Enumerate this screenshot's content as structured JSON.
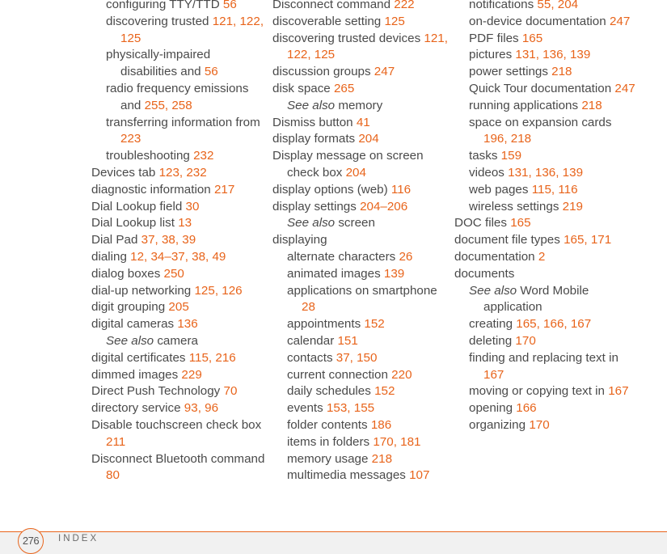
{
  "accent_color": "#e8641b",
  "footer": {
    "page_number": "276",
    "section": "INDEX"
  },
  "columns": [
    [
      {
        "level": 1,
        "text": "configuring TTY/TTD ",
        "pages": "56"
      },
      {
        "level": 1,
        "text": "discovering trusted ",
        "pages": "121, 122, 125"
      },
      {
        "level": 1,
        "text": "physically-impaired disabilities and ",
        "pages": "56"
      },
      {
        "level": 1,
        "text": "radio frequency emissions and ",
        "pages": "255, 258"
      },
      {
        "level": 1,
        "text": "transferring information from ",
        "pages": "223"
      },
      {
        "level": 1,
        "text": "troubleshooting ",
        "pages": "232"
      },
      {
        "level": 0,
        "text": "Devices tab ",
        "pages": "123, 232"
      },
      {
        "level": 0,
        "text": "diagnostic information ",
        "pages": "217"
      },
      {
        "level": 0,
        "text": "Dial Lookup field ",
        "pages": "30"
      },
      {
        "level": 0,
        "text": "Dial Lookup list ",
        "pages": "13"
      },
      {
        "level": 0,
        "text": "Dial Pad ",
        "pages": "37, 38, 39"
      },
      {
        "level": 0,
        "text": "dialing ",
        "pages": "12, 34–37, 38, 49"
      },
      {
        "level": 0,
        "text": "dialog boxes ",
        "pages": "250"
      },
      {
        "level": 0,
        "text": "dial-up networking ",
        "pages": "125, 126"
      },
      {
        "level": 0,
        "text": "digit grouping ",
        "pages": "205"
      },
      {
        "level": 0,
        "text": "digital cameras ",
        "pages": "136"
      },
      {
        "level": 1,
        "see_also": "See also",
        "text": " camera",
        "pages": ""
      },
      {
        "level": 0,
        "text": "digital certificates ",
        "pages": "115, 216"
      },
      {
        "level": 0,
        "text": "dimmed images ",
        "pages": "229"
      },
      {
        "level": 0,
        "text": "Direct Push Technology ",
        "pages": "70"
      },
      {
        "level": 0,
        "text": "directory service ",
        "pages": "93, 96"
      },
      {
        "level": 0,
        "text": "Disable touchscreen check box ",
        "pages": "211"
      },
      {
        "level": 0,
        "text": "Disconnect Bluetooth command ",
        "pages": "80"
      }
    ],
    [
      {
        "level": 0,
        "text": "Disconnect command ",
        "pages": "222"
      },
      {
        "level": 0,
        "text": "discoverable setting ",
        "pages": "125"
      },
      {
        "level": 0,
        "text": "discovering trusted devices ",
        "pages": "121, 122, 125"
      },
      {
        "level": 0,
        "text": "discussion groups ",
        "pages": "247"
      },
      {
        "level": 0,
        "text": "disk space ",
        "pages": "265"
      },
      {
        "level": 1,
        "see_also": "See also",
        "text": " memory",
        "pages": ""
      },
      {
        "level": 0,
        "text": "Dismiss button ",
        "pages": "41"
      },
      {
        "level": 0,
        "text": "display formats ",
        "pages": "204"
      },
      {
        "level": 0,
        "text": "Display message on screen check box ",
        "pages": "204"
      },
      {
        "level": 0,
        "text": "display options (web) ",
        "pages": "116"
      },
      {
        "level": 0,
        "text": "display settings ",
        "pages": "204–206"
      },
      {
        "level": 1,
        "see_also": "See also",
        "text": " screen",
        "pages": ""
      },
      {
        "level": 0,
        "text": "displaying",
        "pages": ""
      },
      {
        "level": 1,
        "text": "alternate characters ",
        "pages": "26"
      },
      {
        "level": 1,
        "text": "animated images ",
        "pages": "139"
      },
      {
        "level": 1,
        "text": "applications on smartphone ",
        "pages": "28"
      },
      {
        "level": 1,
        "text": "appointments ",
        "pages": "152"
      },
      {
        "level": 1,
        "text": "calendar ",
        "pages": "151"
      },
      {
        "level": 1,
        "text": "contacts ",
        "pages": "37, 150"
      },
      {
        "level": 1,
        "text": "current connection ",
        "pages": "220"
      },
      {
        "level": 1,
        "text": "daily schedules ",
        "pages": "152"
      },
      {
        "level": 1,
        "text": "events ",
        "pages": "153, 155"
      },
      {
        "level": 1,
        "text": "folder contents ",
        "pages": "186"
      },
      {
        "level": 1,
        "text": "items in folders ",
        "pages": "170, 181"
      },
      {
        "level": 1,
        "text": "memory usage ",
        "pages": "218"
      },
      {
        "level": 1,
        "text": "multimedia messages ",
        "pages": "107"
      }
    ],
    [
      {
        "level": 1,
        "text": "notifications ",
        "pages": "55, 204"
      },
      {
        "level": 1,
        "text": "on-device documentation ",
        "pages": "247"
      },
      {
        "level": 1,
        "text": "PDF files ",
        "pages": "165"
      },
      {
        "level": 1,
        "text": "pictures ",
        "pages": "131, 136, 139"
      },
      {
        "level": 1,
        "text": "power settings ",
        "pages": "218"
      },
      {
        "level": 1,
        "text": "Quick Tour documentation ",
        "pages": "247"
      },
      {
        "level": 1,
        "text": "running applications ",
        "pages": "218"
      },
      {
        "level": 1,
        "text": "space on expansion cards ",
        "pages": "196, 218"
      },
      {
        "level": 1,
        "text": "tasks ",
        "pages": "159"
      },
      {
        "level": 1,
        "text": "videos ",
        "pages": "131, 136, 139"
      },
      {
        "level": 1,
        "text": "web pages ",
        "pages": "115, 116"
      },
      {
        "level": 1,
        "text": "wireless settings ",
        "pages": "219"
      },
      {
        "level": 0,
        "text": "DOC files ",
        "pages": "165"
      },
      {
        "level": 0,
        "text": "document file types ",
        "pages": "165, 171"
      },
      {
        "level": 0,
        "text": "documentation ",
        "pages": "2"
      },
      {
        "level": 0,
        "text": "documents",
        "pages": ""
      },
      {
        "level": 1,
        "see_also": "See also",
        "text": " Word Mobile application",
        "pages": ""
      },
      {
        "level": 1,
        "text": "creating ",
        "pages": "165, 166, 167"
      },
      {
        "level": 1,
        "text": "deleting ",
        "pages": "170"
      },
      {
        "level": 1,
        "text": "finding and replacing text in ",
        "pages": "167"
      },
      {
        "level": 1,
        "text": "moving or copying text in ",
        "pages": "167"
      },
      {
        "level": 1,
        "text": "opening ",
        "pages": "166"
      },
      {
        "level": 1,
        "text": "organizing ",
        "pages": "170"
      }
    ]
  ]
}
